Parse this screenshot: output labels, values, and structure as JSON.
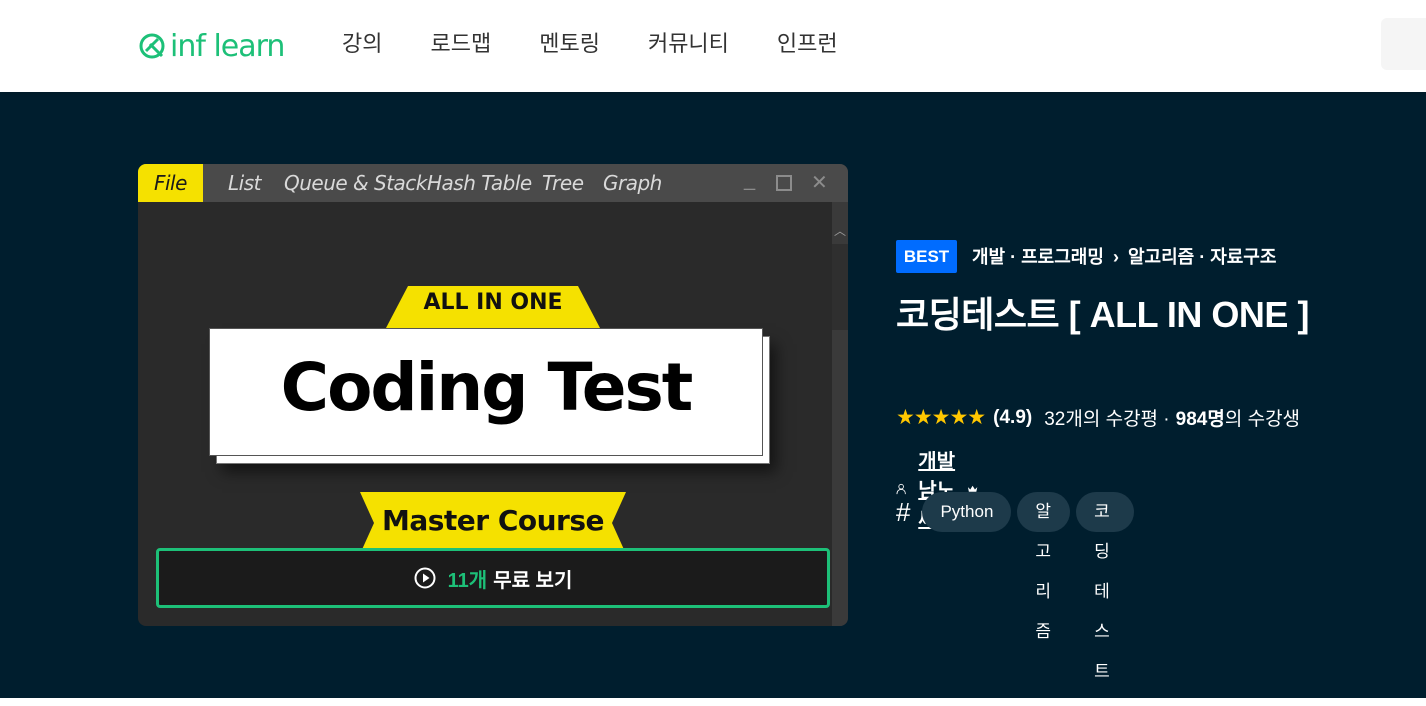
{
  "header": {
    "logo_text": "inf learn",
    "nav": [
      "강의",
      "로드맵",
      "멘토링",
      "커뮤니티",
      "인프런"
    ]
  },
  "thumbnail": {
    "tabs": [
      "File",
      "List",
      "Queue & Stack",
      "Hash Table",
      "Tree",
      "Graph"
    ],
    "active_tab": "File",
    "banner_top": "ALL IN ONE",
    "card_title": "Coding Test",
    "banner_bottom": "Master Course",
    "preview_button": {
      "count": "11개",
      "label": "무료 보기"
    }
  },
  "course": {
    "badge": "BEST",
    "category": "개발 · 프로그래밍",
    "subcategory": "알고리즘 · 자료구조",
    "title": "코딩테스트 [ ALL IN ONE ]",
    "stars": "★★★★★",
    "rating": "(4.9)",
    "review_text": "32개의 수강평 ·",
    "students_count": "984명",
    "students_suffix": "의 수강생",
    "author": "개발남노씨",
    "tags": [
      "Python",
      "알고리즘",
      "코딩 테스트"
    ]
  },
  "colors": {
    "brand": "#1dc078",
    "hero_bg": "#001e2e",
    "best_badge": "#006cff",
    "star": "#ffc700",
    "banner": "#f5e100"
  }
}
